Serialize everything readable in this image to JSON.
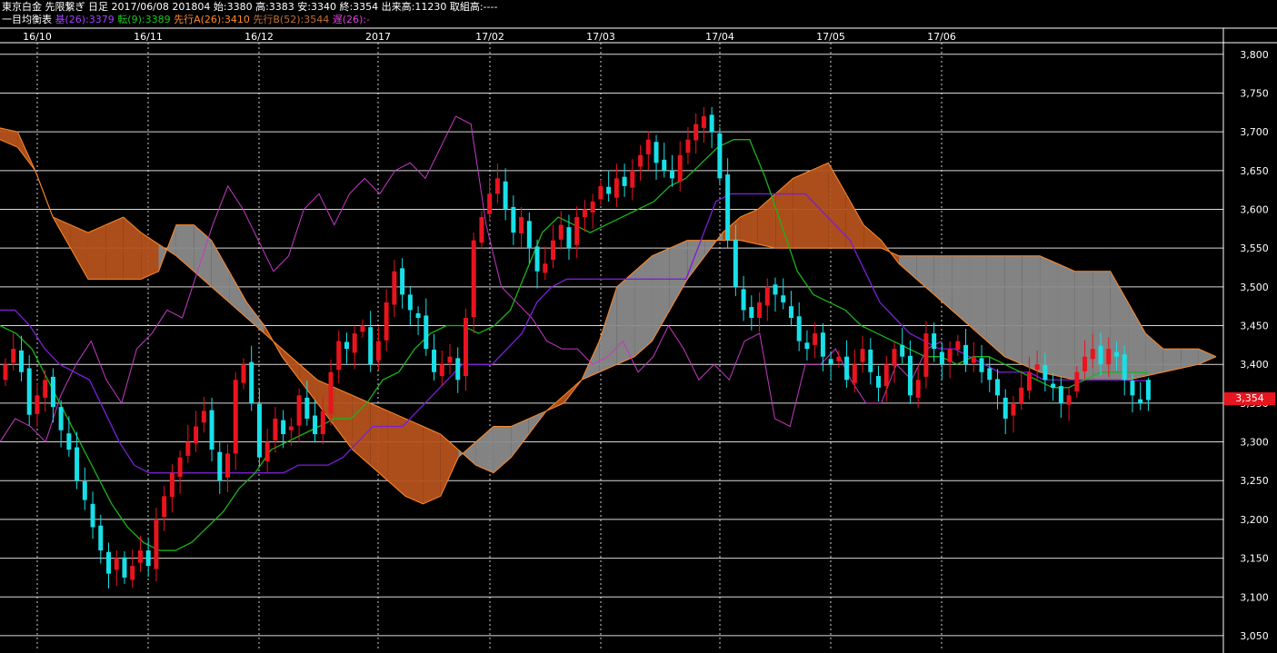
{
  "header": {
    "line1": "東京白金 先限繋ぎ 日足 2017/06/08 201804 始:3380 高:3383 安:3340 終:3354 出来高:11230 取組高:----",
    "indicator_name": "一目均衡表",
    "base": "基(26):3379",
    "conversion": "転(9):3389",
    "span_a": "先行A(26):3410",
    "span_b": "先行B(52):3544",
    "lagging": "遅(26):-"
  },
  "current_price_label": "3,354",
  "colors": {
    "up_candle": "#e8141e",
    "down_candle": "#18e0e8",
    "base_line": "#7a1fd6",
    "conversion_line": "#19b419",
    "lagging_line": "#c43ac4",
    "kumo_bull": "#b5521c",
    "kumo_bear": "#8a8a8a",
    "kumo_edge": "#ff8a2a",
    "grid": "#ffffff",
    "background": "#000000"
  },
  "chart_data": {
    "type": "candlestick",
    "title": "東京白金 先限繋ぎ 日足",
    "x_ticks": [
      "16/10",
      "16/11",
      "16/12",
      "2017",
      "17/02",
      "17/03",
      "17/04",
      "17/05",
      "17/06"
    ],
    "y_ticks": [
      "3,800",
      "3,750",
      "3,700",
      "3,650",
      "3,600",
      "3,550",
      "3,500",
      "3,450",
      "3,400",
      "3,350",
      "3,300",
      "3,250",
      "3,200",
      "3,150",
      "3,100",
      "3,050"
    ],
    "ylim": [
      3030,
      3815
    ],
    "last_bar": {
      "date": "2017/06/08",
      "open": 3380,
      "high": 3383,
      "low": 3340,
      "close": 3354,
      "volume": 11230
    },
    "indicator": {
      "base": 3379,
      "conversion": 3389,
      "span_a": 3410,
      "span_b": 3544
    },
    "closes": [
      3400,
      3420,
      3390,
      3335,
      3360,
      3380,
      3345,
      3315,
      3290,
      3250,
      3225,
      3190,
      3160,
      3130,
      3150,
      3125,
      3140,
      3160,
      3140,
      3200,
      3230,
      3260,
      3280,
      3300,
      3320,
      3340,
      3290,
      3250,
      3285,
      3380,
      3400,
      3350,
      3280,
      3300,
      3330,
      3310,
      3320,
      3360,
      3330,
      3310,
      3340,
      3390,
      3430,
      3420,
      3440,
      3450,
      3400,
      3430,
      3480,
      3520,
      3490,
      3470,
      3460,
      3420,
      3390,
      3400,
      3410,
      3380,
      3460,
      3560,
      3590,
      3620,
      3640,
      3600,
      3570,
      3590,
      3550,
      3520,
      3530,
      3560,
      3580,
      3550,
      3590,
      3600,
      3610,
      3630,
      3620,
      3640,
      3630,
      3650,
      3670,
      3690,
      3660,
      3650,
      3640,
      3670,
      3690,
      3710,
      3720,
      3700,
      3640,
      3560,
      3500,
      3470,
      3460,
      3480,
      3500,
      3490,
      3480,
      3460,
      3430,
      3420,
      3440,
      3410,
      3400,
      3410,
      3380,
      3400,
      3420,
      3390,
      3370,
      3400,
      3420,
      3410,
      3360,
      3380,
      3440,
      3420,
      3400,
      3420,
      3430,
      3400,
      3410,
      3390,
      3380,
      3360,
      3330,
      3350,
      3370,
      3390,
      3400,
      3380,
      3370,
      3350,
      3360,
      3390,
      3410,
      3420,
      3400,
      3420,
      3410,
      3380,
      3360,
      3350,
      3354
    ],
    "series": [
      {
        "name": "基(26)",
        "key": "base",
        "values": [
          3470,
          3470,
          3450,
          3420,
          3400,
          3390,
          3380,
          3340,
          3300,
          3270,
          3260,
          3260,
          3260,
          3260,
          3260,
          3260,
          3260,
          3260,
          3260,
          3260,
          3270,
          3270,
          3270,
          3280,
          3300,
          3320,
          3320,
          3320,
          3340,
          3360,
          3380,
          3400,
          3400,
          3400,
          3420,
          3440,
          3480,
          3500,
          3510,
          3510,
          3510,
          3510,
          3510,
          3510,
          3510,
          3510,
          3510,
          3560,
          3610,
          3620,
          3620,
          3620,
          3620,
          3620,
          3620,
          3600,
          3580,
          3560,
          3520,
          3480,
          3460,
          3440,
          3430,
          3420,
          3420,
          3410,
          3400,
          3390,
          3390,
          3390,
          3380,
          3380,
          3380,
          3380,
          3380,
          3380,
          3379,
          3379
        ]
      },
      {
        "name": "転(9)",
        "key": "conversion",
        "values": [
          3450,
          3440,
          3420,
          3380,
          3340,
          3300,
          3260,
          3220,
          3190,
          3170,
          3160,
          3160,
          3170,
          3190,
          3210,
          3240,
          3260,
          3290,
          3300,
          3310,
          3320,
          3330,
          3330,
          3350,
          3380,
          3390,
          3420,
          3440,
          3450,
          3450,
          3440,
          3450,
          3470,
          3520,
          3570,
          3590,
          3580,
          3570,
          3580,
          3590,
          3600,
          3610,
          3630,
          3640,
          3660,
          3680,
          3690,
          3690,
          3640,
          3580,
          3520,
          3490,
          3480,
          3470,
          3450,
          3440,
          3430,
          3420,
          3410,
          3410,
          3400,
          3410,
          3410,
          3400,
          3390,
          3380,
          3370,
          3370,
          3380,
          3390,
          3390,
          3390,
          3389
        ]
      },
      {
        "name": "遅(26)",
        "key": "lagging",
        "values": [
          3300,
          3330,
          3320,
          3300,
          3360,
          3400,
          3430,
          3380,
          3350,
          3420,
          3440,
          3470,
          3460,
          3520,
          3580,
          3630,
          3600,
          3560,
          3520,
          3540,
          3600,
          3620,
          3580,
          3620,
          3640,
          3620,
          3650,
          3660,
          3640,
          3680,
          3720,
          3710,
          3580,
          3500,
          3480,
          3460,
          3430,
          3420,
          3420,
          3400,
          3410,
          3430,
          3390,
          3410,
          3450,
          3420,
          3380,
          3400,
          3380,
          3430,
          3440,
          3330,
          3320,
          3400,
          3400,
          3420,
          3380,
          3350,
          3350,
          3400,
          3380,
          3420,
          3430
        ]
      },
      {
        "name": "先行A(26)",
        "key": "span_a",
        "values": [
          3705,
          3700,
          3650,
          3590,
          3580,
          3570,
          3580,
          3590,
          3570,
          3555,
          3540,
          3520,
          3500,
          3480,
          3460,
          3440,
          3420,
          3400,
          3380,
          3370,
          3360,
          3350,
          3340,
          3330,
          3320,
          3310,
          3290,
          3270,
          3260,
          3280,
          3310,
          3340,
          3360,
          3380,
          3390,
          3400,
          3410,
          3430,
          3470,
          3510,
          3540,
          3570,
          3590,
          3600,
          3620,
          3640,
          3650,
          3660,
          3620,
          3580,
          3560,
          3530,
          3510,
          3490,
          3470,
          3450,
          3430,
          3410,
          3400,
          3390,
          3385,
          3380,
          3380,
          3380,
          3380,
          3385,
          3390,
          3395,
          3400,
          3410
        ]
      },
      {
        "name": "先行B(52)",
        "key": "span_b",
        "values": [
          3690,
          3680,
          3650,
          3590,
          3550,
          3510,
          3510,
          3510,
          3510,
          3520,
          3580,
          3580,
          3560,
          3520,
          3480,
          3450,
          3410,
          3380,
          3350,
          3320,
          3290,
          3270,
          3250,
          3230,
          3220,
          3230,
          3280,
          3300,
          3320,
          3320,
          3330,
          3340,
          3350,
          3380,
          3430,
          3500,
          3520,
          3540,
          3550,
          3560,
          3560,
          3560,
          3560,
          3555,
          3550,
          3550,
          3550,
          3550,
          3550,
          3550,
          3550,
          3540,
          3540,
          3540,
          3540,
          3540,
          3540,
          3540,
          3540,
          3540,
          3530,
          3520,
          3520,
          3520,
          3480,
          3440,
          3420,
          3420,
          3420,
          3410
        ]
      }
    ]
  }
}
